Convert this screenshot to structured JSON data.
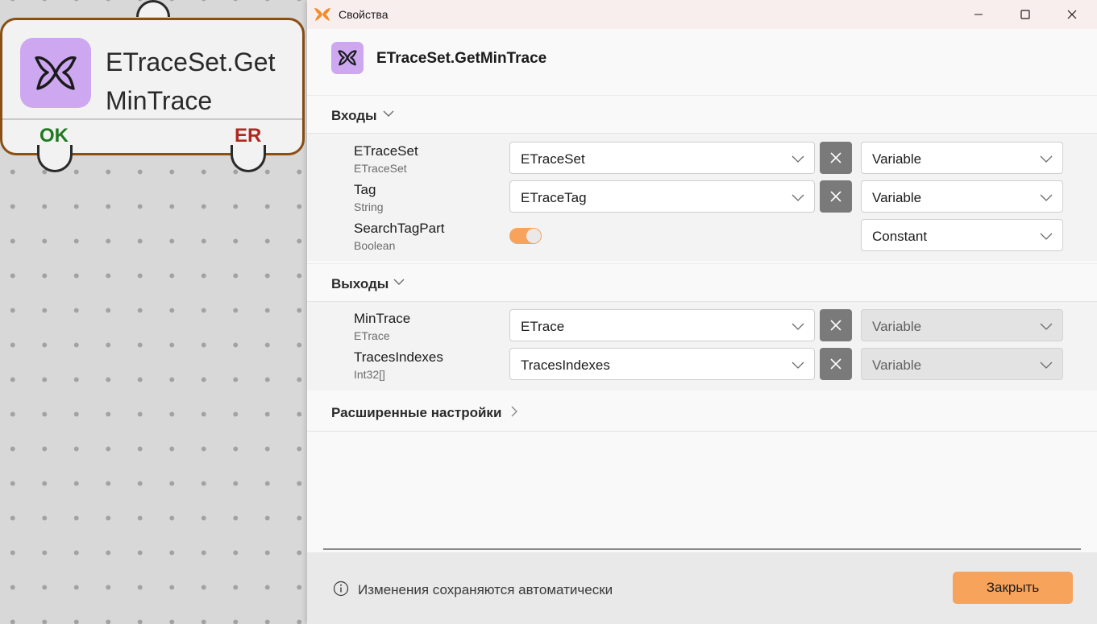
{
  "node": {
    "title": "ETraceSet.GetMinTrace",
    "ok_label": "OK",
    "er_label": "ER",
    "icon": "butterfly-icon"
  },
  "dialog": {
    "window_title": "Свойства",
    "header_title": "ETraceSet.GetMinTrace",
    "inputs_section": {
      "label": "Входы",
      "rows": [
        {
          "name": "ETraceSet",
          "type": "ETraceSet",
          "value": "ETraceSet",
          "mode": "Variable"
        },
        {
          "name": "Tag",
          "type": "String",
          "value": "ETraceTag",
          "mode": "Variable"
        },
        {
          "name": "SearchTagPart",
          "type": "Boolean",
          "toggle_on": true,
          "mode": "Constant"
        }
      ]
    },
    "outputs_section": {
      "label": "Выходы",
      "rows": [
        {
          "name": "MinTrace",
          "type": "ETrace",
          "value": "ETrace",
          "mode": "Variable"
        },
        {
          "name": "TracesIndexes",
          "type": "Int32[]",
          "value": "TracesIndexes",
          "mode": "Variable"
        }
      ]
    },
    "advanced_label": "Расширенные настройки",
    "footer_info": "Изменения сохраняются автоматически",
    "close_button": "Закрыть"
  },
  "colors": {
    "accent_orange": "#f7a35c",
    "icon_purple": "#cda8f0",
    "node_border": "#8a4f12",
    "ok_green": "#1f7a1f",
    "er_red": "#b0281e"
  }
}
